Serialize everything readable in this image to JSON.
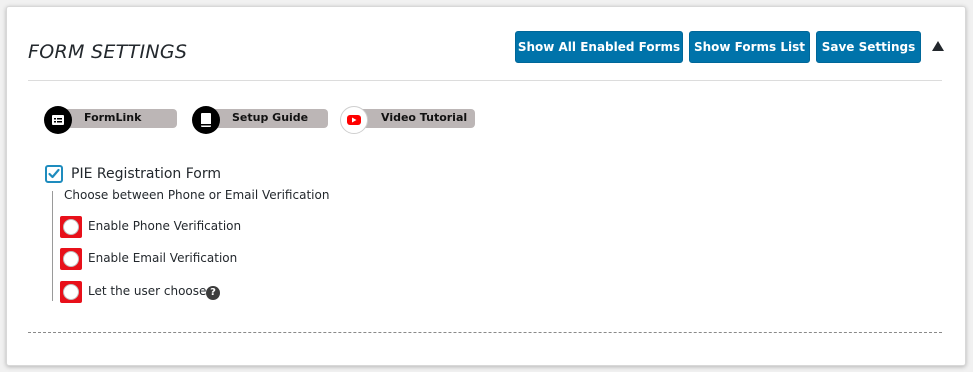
{
  "header": {
    "title": "FORM SETTINGS",
    "buttons": {
      "show_all_enabled": "Show All Enabled Forms",
      "show_forms_list": "Show Forms List",
      "save_settings": "Save Settings"
    },
    "collapse_icon": "triangle-up-icon"
  },
  "links": [
    {
      "label": "FormLink",
      "icon": "form-icon"
    },
    {
      "label": "Setup Guide",
      "icon": "document-icon"
    },
    {
      "label": "Video Tutorial",
      "icon": "youtube-icon"
    }
  ],
  "form": {
    "title": "PIE Registration Form",
    "checked": true,
    "description": "Choose between Phone or Email Verification",
    "options": [
      {
        "label": "Enable Phone Verification",
        "selected": false
      },
      {
        "label": "Enable Email Verification",
        "selected": false
      },
      {
        "label": "Let the user choose",
        "selected": false,
        "help": "?"
      }
    ]
  },
  "colors": {
    "primary_button": "#0073aa",
    "checkbox_border": "#1e8cbe",
    "radio_highlight": "#e8101a",
    "pill_background": "#bcb6b6"
  }
}
